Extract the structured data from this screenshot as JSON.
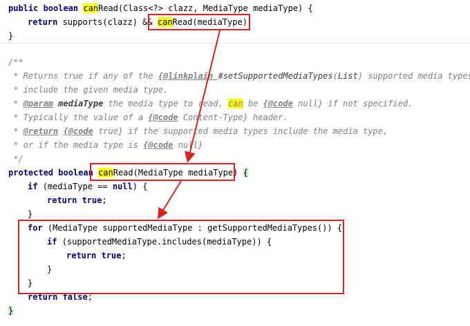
{
  "colors": {
    "keyword": "#000080",
    "comment": "#808080",
    "highlight": "#ffff00",
    "annotation_box": "#e02020"
  },
  "code": {
    "l1": {
      "kw": "public boolean ",
      "hl": "can",
      "rest": "Read(Class<?> clazz, MediaType mediaType) {"
    },
    "l2": {
      "kw": "return ",
      "pre": "supports(clazz) && ",
      "hl": "can",
      "rest": "Read(mediaType);"
    },
    "l3": "}",
    "doc1": "/**",
    "doc2": {
      "a": " * Returns true if any of the ",
      "b": "{@linkplain ",
      "c": "#setSupportedMediaTypes",
      "d": "(",
      "e": "List",
      "f": ") supported media types}"
    },
    "doc3": " * include the given media type.",
    "doc4": {
      "a": " * ",
      "tag": "@param",
      "b": " ",
      "name": "mediaType",
      "c": " the media type to read, ",
      "hl": "can",
      "d": " be ",
      "e": "{@code",
      "f": " null} if not specified."
    },
    "doc5": {
      "a": " * Typically the value of a ",
      "e": "{@code",
      "f": " Content-Type} header."
    },
    "doc6": {
      "a": " * ",
      "tag": "@return",
      "b": " ",
      "e": "{@code",
      "f": " true} if the supported media types include the media type,"
    },
    "doc7": {
      "a": " * or if the media type is ",
      "e": "{@code",
      "f": " null}"
    },
    "doc8": " */",
    "l4": {
      "kw": "protected boolean ",
      "hl": "can",
      "rest": "Read(MediaType mediaType) ",
      "brace": "{"
    },
    "l5": {
      "kw": "if ",
      "rest": "(mediaType == ",
      "kw2": "null",
      "rest2": ") {"
    },
    "l6": {
      "kw": "return ",
      "kw2": "true",
      "rest": ";"
    },
    "l7": "}",
    "l8": {
      "kw": "for ",
      "rest": "(MediaType supportedMediaType : getSupportedMediaTypes()) {"
    },
    "l9": {
      "kw": "if ",
      "rest": "(supportedMediaType.includes(mediaType)) {"
    },
    "l10": {
      "kw": "return ",
      "kw2": "true",
      "rest": ";"
    },
    "l11": "}",
    "l12": "}",
    "l13": {
      "kw": "return ",
      "kw2": "false",
      "rest": ";"
    },
    "l14": "}"
  }
}
